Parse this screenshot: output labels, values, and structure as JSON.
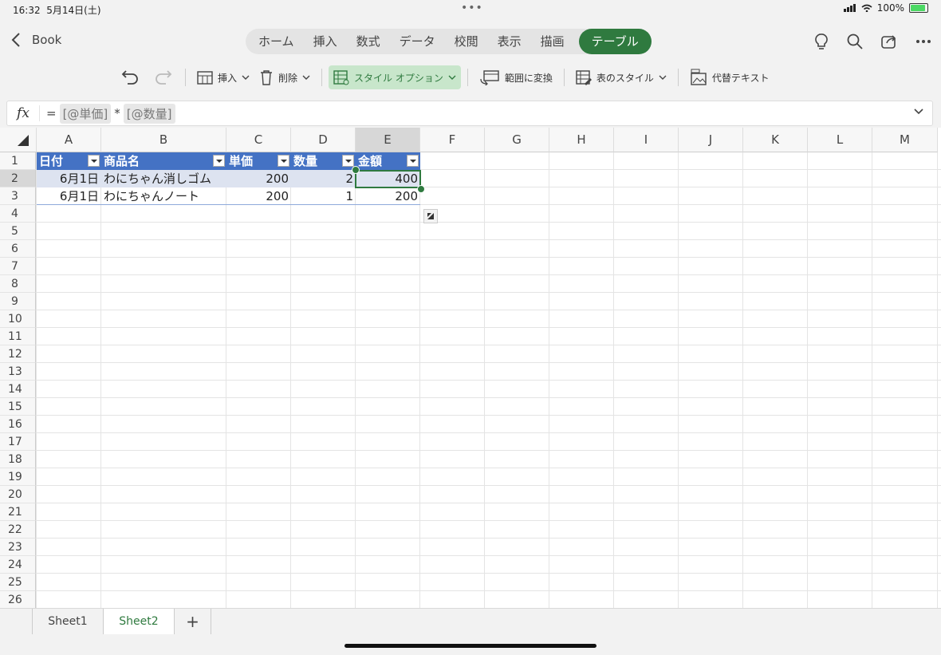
{
  "status": {
    "time": "16:32",
    "date": "5月14日(土)",
    "battery": "100%"
  },
  "nav": {
    "back_label": "Book",
    "tabs": [
      "ホーム",
      "挿入",
      "数式",
      "データ",
      "校閲",
      "表示",
      "描画",
      "テーブル"
    ],
    "active_tab": "テーブル"
  },
  "toolbar": {
    "insert": "挿入",
    "delete": "削除",
    "style_options": "スタイル オプション",
    "convert_range": "範囲に変換",
    "table_style": "表のスタイル",
    "alt_text": "代替テキスト"
  },
  "formula": {
    "fx": "fx",
    "eq": "=",
    "ref1": "[@単価]",
    "op": "*",
    "ref2": "[@数量]"
  },
  "grid": {
    "columns": [
      "A",
      "B",
      "C",
      "D",
      "E",
      "F",
      "G",
      "H",
      "I",
      "J",
      "K",
      "L",
      "M"
    ],
    "selected_column": "E",
    "rows": [
      "1",
      "2",
      "3",
      "4",
      "5",
      "6",
      "7",
      "8",
      "9",
      "10",
      "11",
      "12",
      "13",
      "14",
      "15",
      "16",
      "17",
      "18",
      "19",
      "20",
      "21",
      "22",
      "23",
      "24",
      "25",
      "26"
    ],
    "selected_row": "2",
    "table": {
      "headers": [
        "日付",
        "商品名",
        "単価",
        "数量",
        "金額"
      ],
      "rows": [
        [
          "6月1日",
          "わにちゃん消しゴム",
          "200",
          "2",
          "400"
        ],
        [
          "6月1日",
          "わにちゃんノート",
          "200",
          "1",
          "200"
        ]
      ]
    }
  },
  "sheets": {
    "tabs": [
      "Sheet1",
      "Sheet2"
    ],
    "active": "Sheet2",
    "add": "+"
  },
  "colors": {
    "accent": "#2f7a3f",
    "table_header": "#4472c4",
    "table_band": "#dde3f0"
  }
}
